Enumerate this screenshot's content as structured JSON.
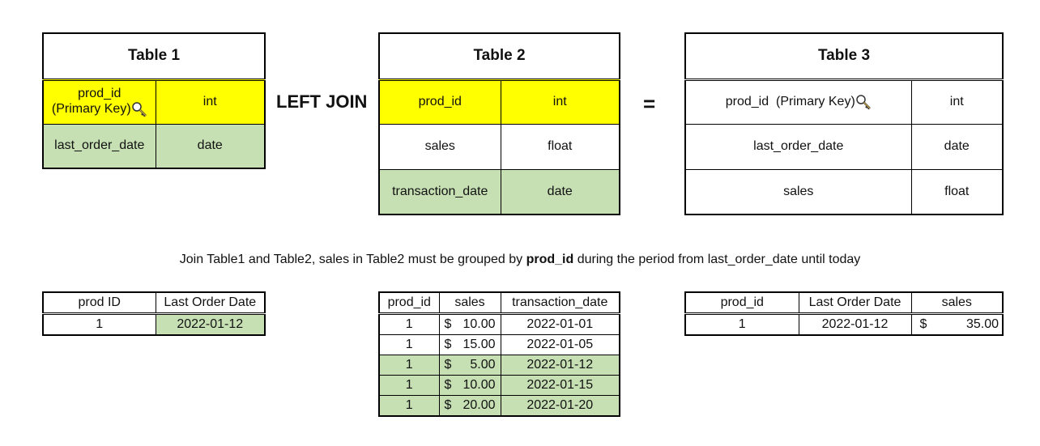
{
  "table1": {
    "title": "Table 1",
    "rows": [
      {
        "field_line1": "prod_id",
        "field_line2": "(Primary Key)",
        "type": "int",
        "icon": "key-icon"
      },
      {
        "field": "last_order_date",
        "type": "date"
      }
    ]
  },
  "operator_join": "LEFT JOIN",
  "table2": {
    "title": "Table 2",
    "rows": [
      {
        "field": "prod_id",
        "type": "int"
      },
      {
        "field": "sales",
        "type": "float"
      },
      {
        "field": "transaction_date",
        "type": "date"
      }
    ]
  },
  "operator_equals": "=",
  "table3": {
    "title": "Table 3",
    "rows": [
      {
        "field": "prod_id  (Primary Key)",
        "type": "int",
        "icon": "key-icon"
      },
      {
        "field": "last_order_date",
        "type": "date"
      },
      {
        "field": "sales",
        "type": "float"
      }
    ]
  },
  "caption": {
    "before": "Join Table1 and Table2, sales in Table2 must be grouped by ",
    "bold": "prod_id",
    "after": " during the period from last_order_date until today"
  },
  "data1": {
    "headers": [
      "prod ID",
      "Last Order Date"
    ],
    "rows": [
      [
        "1",
        "2022-01-12"
      ]
    ]
  },
  "data2": {
    "headers": [
      "prod_id",
      "sales",
      "transaction_date"
    ],
    "rows": [
      {
        "prod_id": "1",
        "currency": "$",
        "amount": "10.00",
        "date": "2022-01-01"
      },
      {
        "prod_id": "1",
        "currency": "$",
        "amount": "15.00",
        "date": "2022-01-05"
      },
      {
        "prod_id": "1",
        "currency": "$",
        "amount": "5.00",
        "date": "2022-01-12"
      },
      {
        "prod_id": "1",
        "currency": "$",
        "amount": "10.00",
        "date": "2022-01-15"
      },
      {
        "prod_id": "1",
        "currency": "$",
        "amount": "20.00",
        "date": "2022-01-20"
      }
    ]
  },
  "data3": {
    "headers": [
      "prod_id",
      "Last Order Date",
      "sales"
    ],
    "rows": [
      {
        "prod_id": "1",
        "date": "2022-01-12",
        "currency": "$",
        "amount": "35.00"
      }
    ]
  },
  "colors": {
    "key_highlight": "#ffff00",
    "date_highlight": "#c6e0b4"
  }
}
